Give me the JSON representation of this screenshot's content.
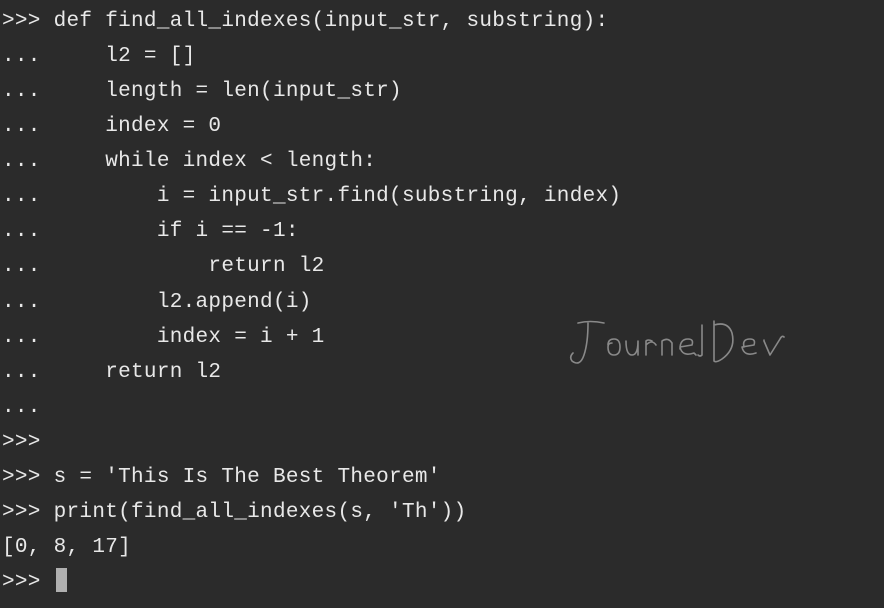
{
  "terminal": {
    "lines": [
      ">>> def find_all_indexes(input_str, substring):",
      "...     l2 = []",
      "...     length = len(input_str)",
      "...     index = 0",
      "...     while index < length:",
      "...         i = input_str.find(substring, index)",
      "...         if i == -1:",
      "...             return l2",
      "...         l2.append(i)",
      "...         index = i + 1",
      "...     return l2",
      "... ",
      ">>> ",
      ">>> s = 'This Is The Best Theorem'",
      ">>> print(find_all_indexes(s, 'Th'))",
      "[0, 8, 17]",
      ">>> "
    ],
    "cursor_line_index": 16
  },
  "watermark": {
    "text": "JournalDev"
  }
}
